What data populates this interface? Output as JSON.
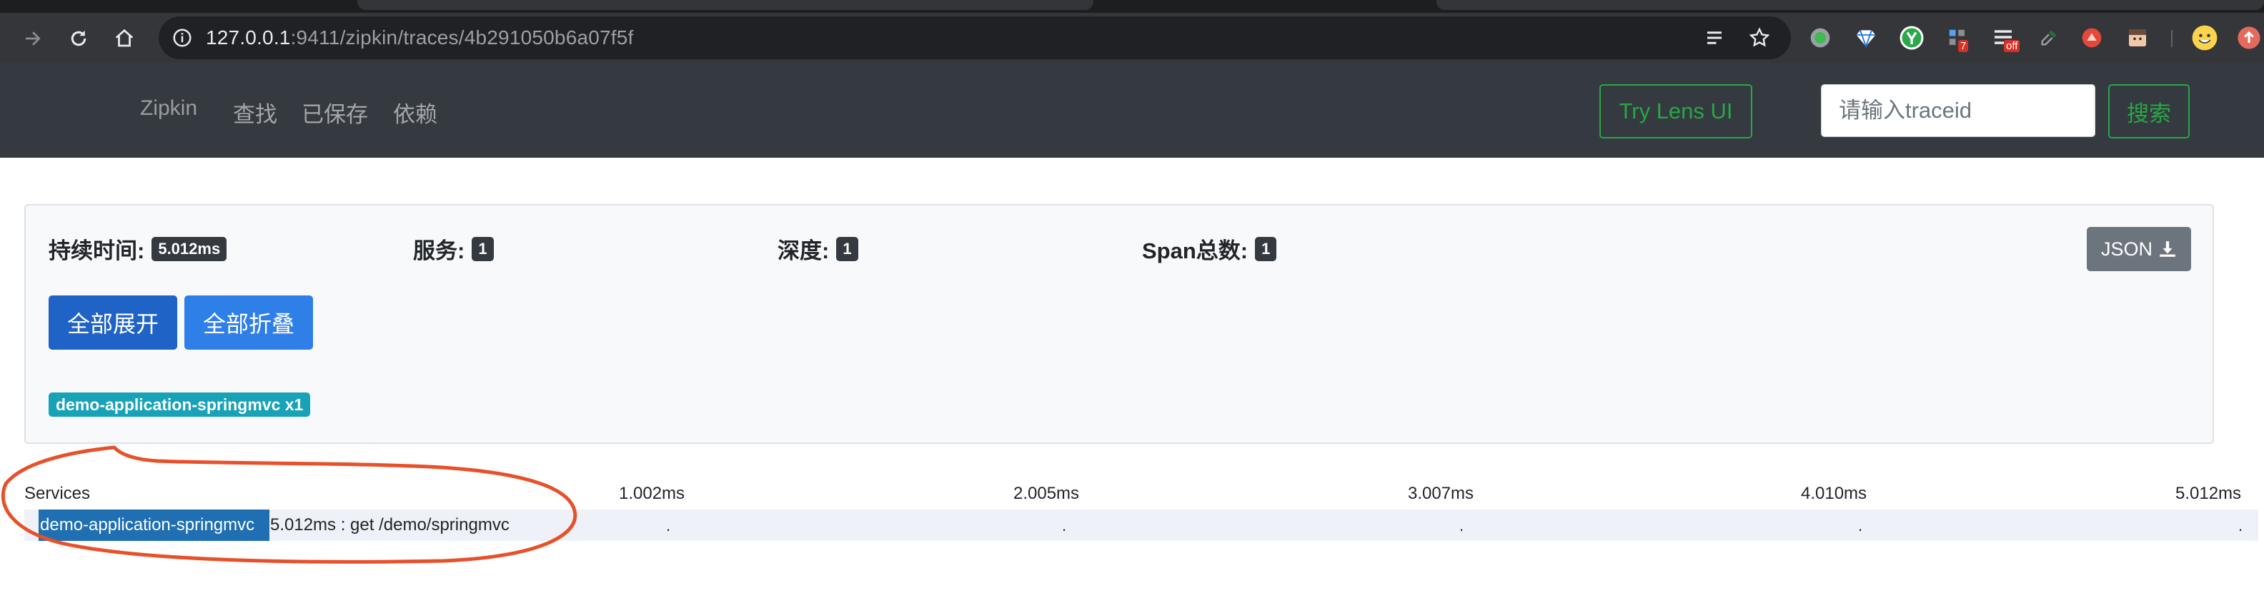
{
  "browser": {
    "url_host": "127.0.0.1",
    "url_rest": ":9411/zipkin/traces/4b291050b6a07f5f",
    "extension_badges": {
      "seven": "7",
      "off": "off"
    }
  },
  "navbar": {
    "brand": "Zipkin",
    "links": [
      "查找",
      "已保存",
      "依赖"
    ],
    "lens_button": "Try Lens UI",
    "traceid_placeholder": "请输入traceid",
    "search_button": "搜索"
  },
  "summary": {
    "duration_label": "持续时间:",
    "duration_value": "5.012ms",
    "services_label": "服务:",
    "services_value": "1",
    "depth_label": "深度:",
    "depth_value": "1",
    "span_count_label": "Span总数:",
    "span_count_value": "1",
    "json_button": "JSON",
    "expand_all": "全部展开",
    "collapse_all": "全部折叠",
    "service_badge": "demo-application-springmvc x1"
  },
  "timeline": {
    "services_header": "Services",
    "ticks": [
      "1.002ms",
      "2.005ms",
      "3.007ms",
      "4.010ms",
      "5.012ms"
    ],
    "row": {
      "service": "demo-application-springmvc",
      "span": "5.012ms : get /demo/springmvc"
    }
  },
  "colors": {
    "navbar_bg": "#343a40",
    "success": "#28a745",
    "primary_active": "#1f63c6",
    "primary": "#2f7fe8",
    "info": "#17a2b8",
    "annotation": "#e8502a"
  }
}
